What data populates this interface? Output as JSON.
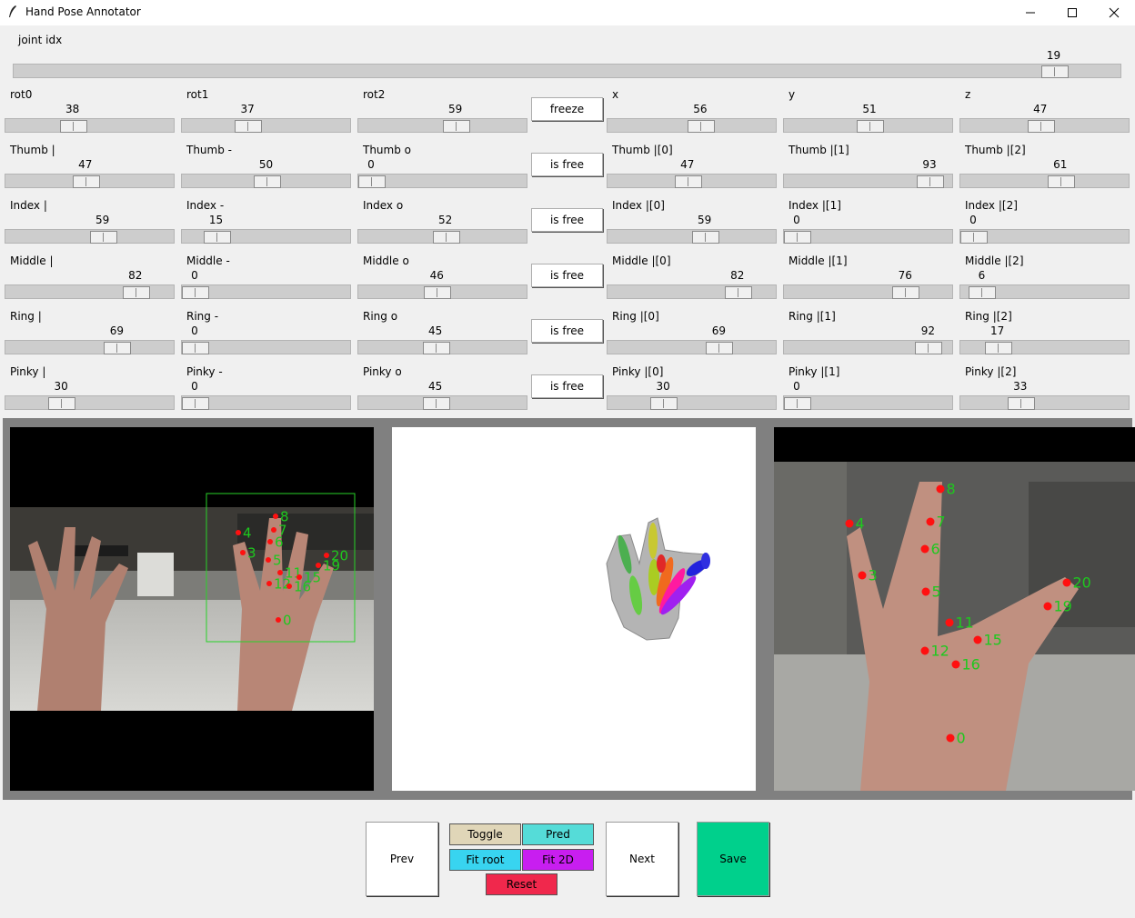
{
  "window": {
    "title": "Hand Pose Annotator"
  },
  "joint_idx": {
    "label": "joint idx",
    "value": "19",
    "fraction": 0.95
  },
  "rows": [
    {
      "cells": [
        {
          "label": "rot0",
          "value": "38",
          "fraction": 0.38
        },
        {
          "label": "rot1",
          "value": "37",
          "fraction": 0.37
        },
        {
          "label": "rot2",
          "value": "59",
          "fraction": 0.59
        },
        {
          "button": "freeze"
        },
        {
          "label": "x",
          "value": "56",
          "fraction": 0.56
        },
        {
          "label": "y",
          "value": "51",
          "fraction": 0.51
        },
        {
          "label": "z",
          "value": "47",
          "fraction": 0.47
        }
      ]
    },
    {
      "cells": [
        {
          "label": "Thumb |",
          "value": "47",
          "fraction": 0.47
        },
        {
          "label": "Thumb -",
          "value": "50",
          "fraction": 0.5
        },
        {
          "label": "Thumb o",
          "value": "0",
          "fraction": 0.0
        },
        {
          "button": "is free"
        },
        {
          "label": "Thumb |[0]",
          "value": "47",
          "fraction": 0.47
        },
        {
          "label": "Thumb |[1]",
          "value": "93",
          "fraction": 0.93
        },
        {
          "label": "Thumb |[2]",
          "value": "61",
          "fraction": 0.61
        }
      ]
    },
    {
      "cells": [
        {
          "label": "Index |",
          "value": "59",
          "fraction": 0.59
        },
        {
          "label": "Index -",
          "value": "15",
          "fraction": 0.15
        },
        {
          "label": "Index o",
          "value": "52",
          "fraction": 0.52
        },
        {
          "button": "is free"
        },
        {
          "label": "Index |[0]",
          "value": "59",
          "fraction": 0.59
        },
        {
          "label": "Index |[1]",
          "value": "0",
          "fraction": 0.0
        },
        {
          "label": "Index |[2]",
          "value": "0",
          "fraction": 0.0
        }
      ]
    },
    {
      "cells": [
        {
          "label": "Middle |",
          "value": "82",
          "fraction": 0.82
        },
        {
          "label": "Middle -",
          "value": "0",
          "fraction": 0.0
        },
        {
          "label": "Middle o",
          "value": "46",
          "fraction": 0.46
        },
        {
          "button": "is free"
        },
        {
          "label": "Middle |[0]",
          "value": "82",
          "fraction": 0.82
        },
        {
          "label": "Middle |[1]",
          "value": "76",
          "fraction": 0.76
        },
        {
          "label": "Middle |[2]",
          "value": "6",
          "fraction": 0.06
        }
      ]
    },
    {
      "cells": [
        {
          "label": "Ring |",
          "value": "69",
          "fraction": 0.69
        },
        {
          "label": "Ring -",
          "value": "0",
          "fraction": 0.0
        },
        {
          "label": "Ring o",
          "value": "45",
          "fraction": 0.45
        },
        {
          "button": "is free"
        },
        {
          "label": "Ring |[0]",
          "value": "69",
          "fraction": 0.69
        },
        {
          "label": "Ring |[1]",
          "value": "92",
          "fraction": 0.92
        },
        {
          "label": "Ring |[2]",
          "value": "17",
          "fraction": 0.17
        }
      ]
    },
    {
      "cells": [
        {
          "label": "Pinky |",
          "value": "30",
          "fraction": 0.3
        },
        {
          "label": "Pinky -",
          "value": "0",
          "fraction": 0.0
        },
        {
          "label": "Pinky o",
          "value": "45",
          "fraction": 0.45
        },
        {
          "button": "is free"
        },
        {
          "label": "Pinky |[0]",
          "value": "30",
          "fraction": 0.3
        },
        {
          "label": "Pinky |[1]",
          "value": "0",
          "fraction": 0.0
        },
        {
          "label": "Pinky |[2]",
          "value": "33",
          "fraction": 0.33
        }
      ]
    }
  ],
  "keypoint_labels": {
    "left": [
      "8",
      "4",
      "7",
      "6",
      "3",
      "5",
      "20",
      "19",
      "11",
      "15",
      "12",
      "16",
      "0"
    ],
    "right": [
      "8",
      "4",
      "7",
      "6",
      "3",
      "5",
      "20",
      "19",
      "11",
      "15",
      "12",
      "16",
      "0"
    ]
  },
  "buttons": {
    "prev": "Prev",
    "toggle": "Toggle",
    "pred": "Pred",
    "fit_root": "Fit root",
    "fit_2d": "Fit 2D",
    "reset": "Reset",
    "next": "Next",
    "save": "Save"
  },
  "colors": {
    "toggle": "#e0d6b8",
    "pred": "#55dcd8",
    "fit_root": "#38d4f0",
    "fit_2d": "#c81ef0",
    "reset": "#f0284c",
    "save": "#00d08c",
    "keypoint": "#ff1010",
    "keypoint_label": "#1ec81e",
    "bbox": "#28d228"
  }
}
